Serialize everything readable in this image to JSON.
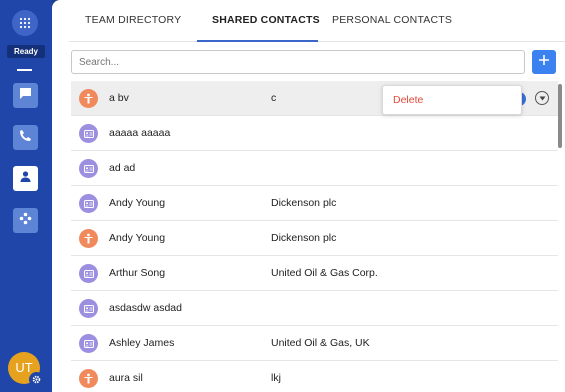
{
  "sidebar": {
    "status": "Ready",
    "user_initials": "UT",
    "icons": [
      "dialpad-icon",
      "chat-icon",
      "phone-icon",
      "contacts-icon",
      "integrations-icon"
    ]
  },
  "tabs": [
    {
      "label": "TEAM DIRECTORY",
      "active": false
    },
    {
      "label": "SHARED CONTACTS",
      "active": true
    },
    {
      "label": "PERSONAL CONTACTS",
      "active": false
    }
  ],
  "search": {
    "placeholder": "Search..."
  },
  "context_menu": {
    "delete_label": "Delete"
  },
  "contacts": [
    {
      "name": "a bv",
      "company": "c",
      "type": "user"
    },
    {
      "name": "aaaaa aaaaa",
      "company": "",
      "type": "card"
    },
    {
      "name": "ad ad",
      "company": "",
      "type": "card"
    },
    {
      "name": "Andy Young",
      "company": "Dickenson plc",
      "type": "card"
    },
    {
      "name": "Andy Young",
      "company": "Dickenson plc",
      "type": "user"
    },
    {
      "name": "Arthur Song",
      "company": "United Oil & Gas Corp.",
      "type": "card"
    },
    {
      "name": "asdasdw asdad",
      "company": "",
      "type": "card"
    },
    {
      "name": "Ashley James",
      "company": "United Oil & Gas, UK",
      "type": "card"
    },
    {
      "name": "aura sil",
      "company": "lkj",
      "type": "user"
    }
  ],
  "colors": {
    "sidebar": "#1f46a8",
    "accent": "#3b82f0",
    "delete": "#e04a3b",
    "card_icon": "#9c8fe0",
    "user_icon": "#f08a5d"
  }
}
